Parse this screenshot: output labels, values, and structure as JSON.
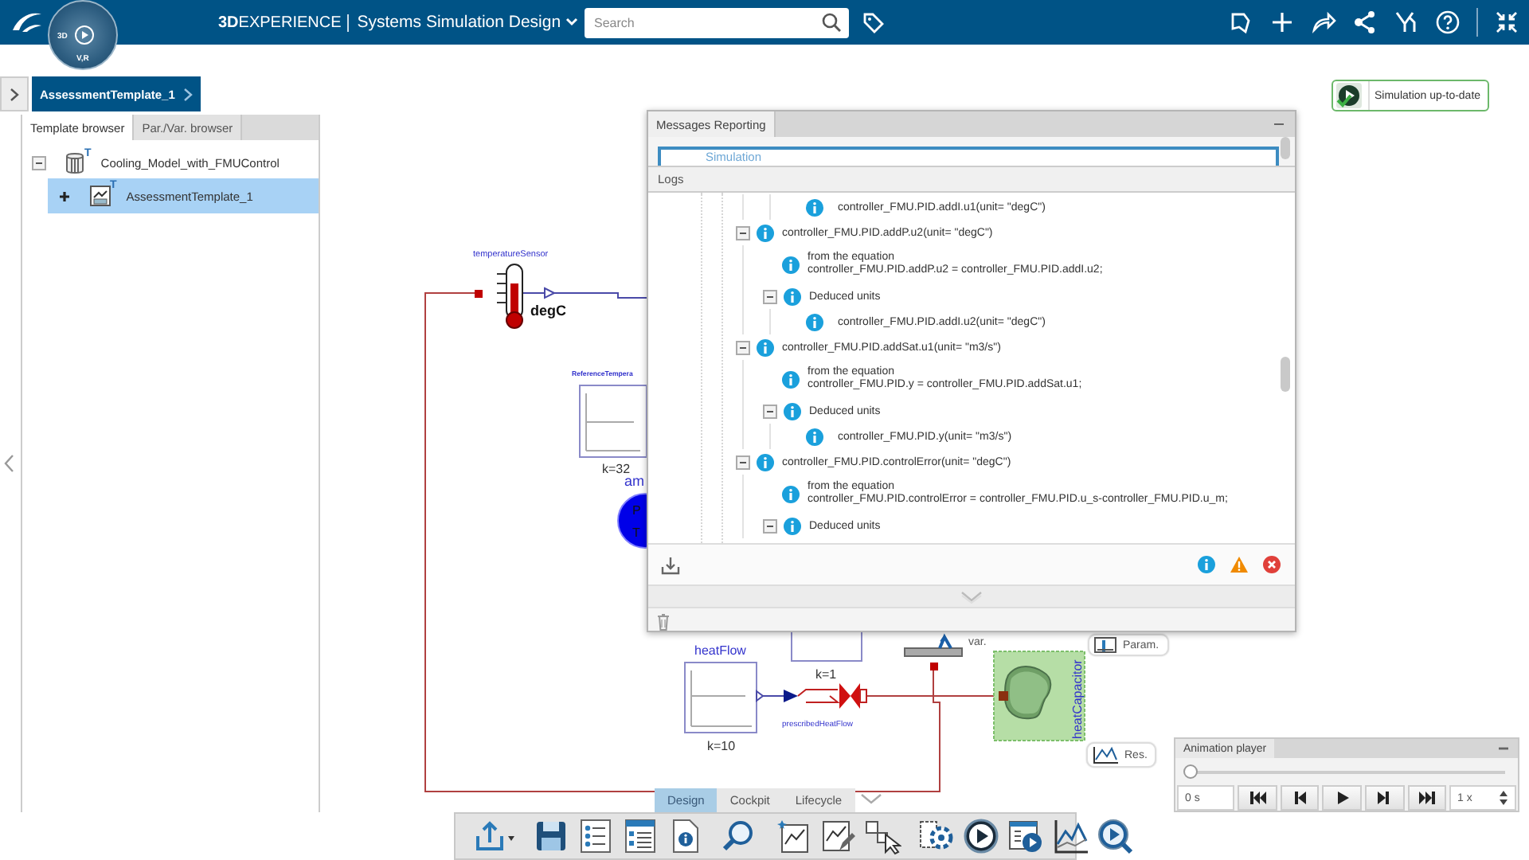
{
  "topbar": {
    "compass": {
      "top": "3D",
      "bottom": "V,R"
    },
    "brand": "**3D**EXPERIENCE",
    "app_title": "Systems Simulation Design",
    "search": {
      "placeholder": "Search"
    }
  },
  "breadcrumb": {
    "label": "AssessmentTemplate_1"
  },
  "status": {
    "label": "Simulation up-to-date"
  },
  "browser": {
    "tabs": [
      {
        "label": "Template browser",
        "selected": true
      },
      {
        "label": "Par./Var. browser",
        "selected": false
      }
    ],
    "tree": [
      {
        "kind": "model",
        "badge": "T",
        "label": "Cooling_Model_with_FMUControl",
        "expanded": true,
        "selected": false,
        "children": [
          {
            "kind": "template",
            "badge": "T",
            "label": "AssessmentTemplate_1",
            "expanded": false,
            "selected": true
          }
        ]
      }
    ]
  },
  "messages": {
    "title": "Messages Reporting",
    "filter": "Simulation",
    "section": "Logs",
    "entries": [
      {
        "kind": "continued",
        "children": [
          {
            "kind": "continued",
            "children": [
              {
                "kind": "leaf",
                "text": "controller_FMU.PID.addI.u1(unit= \"degC\")"
              }
            ]
          }
        ]
      },
      {
        "kind": "item",
        "text": "controller_FMU.PID.addP.u2(unit= \"degC\")",
        "expanded": true,
        "children": [
          {
            "kind": "note",
            "title": "from the equation",
            "text": "controller_FMU.PID.addP.u2 = controller_FMU.PID.addI.u2;"
          },
          {
            "kind": "item",
            "text": "Deduced units",
            "expanded": true,
            "children": [
              {
                "kind": "leaf",
                "text": "controller_FMU.PID.addI.u2(unit= \"degC\")"
              }
            ]
          }
        ]
      },
      {
        "kind": "item",
        "text": "controller_FMU.PID.addSat.u1(unit= \"m3/s\")",
        "expanded": true,
        "children": [
          {
            "kind": "note",
            "title": "from the equation",
            "text": "controller_FMU.PID.y = controller_FMU.PID.addSat.u1;"
          },
          {
            "kind": "item",
            "text": "Deduced units",
            "expanded": true,
            "children": [
              {
                "kind": "leaf",
                "text": "controller_FMU.PID.y(unit= \"m3/s\")"
              }
            ]
          }
        ]
      },
      {
        "kind": "item",
        "text": "controller_FMU.PID.controlError(unit= \"degC\")",
        "expanded": true,
        "children": [
          {
            "kind": "note",
            "title": "from the equation",
            "text": "controller_FMU.PID.controlError = controller_FMU.PID.u_s-controller_FMU.PID.u_m;"
          },
          {
            "kind": "item",
            "text": "Deduced units",
            "expanded": true
          }
        ]
      }
    ]
  },
  "diagram": {
    "sensor": {
      "name": "temperatureSensor",
      "unit": "degC"
    },
    "reference": {
      "name": "ReferenceTempera",
      "param": "k=32"
    },
    "ambient": {
      "name": "am",
      "letters": [
        "P",
        "T"
      ]
    },
    "heat_flow": {
      "name": "heatFlow",
      "param": "k=10"
    },
    "prescribed": {
      "name": "prescribedHeatFlow"
    },
    "gain": {
      "param": "k=1"
    },
    "variable": {
      "label": "var."
    },
    "capacitor": {
      "name": "heatCapacitor"
    },
    "chips": [
      {
        "kind": "param",
        "label": "Param."
      },
      {
        "kind": "results",
        "label": "Res."
      }
    ]
  },
  "mode_tabs": [
    {
      "label": "Design",
      "selected": true
    },
    {
      "label": "Cockpit",
      "selected": false
    },
    {
      "label": "Lifecycle",
      "selected": false
    }
  ],
  "animation_player": {
    "title": "Animation player",
    "level": 0,
    "time": "0 s",
    "speed": "1 x"
  }
}
